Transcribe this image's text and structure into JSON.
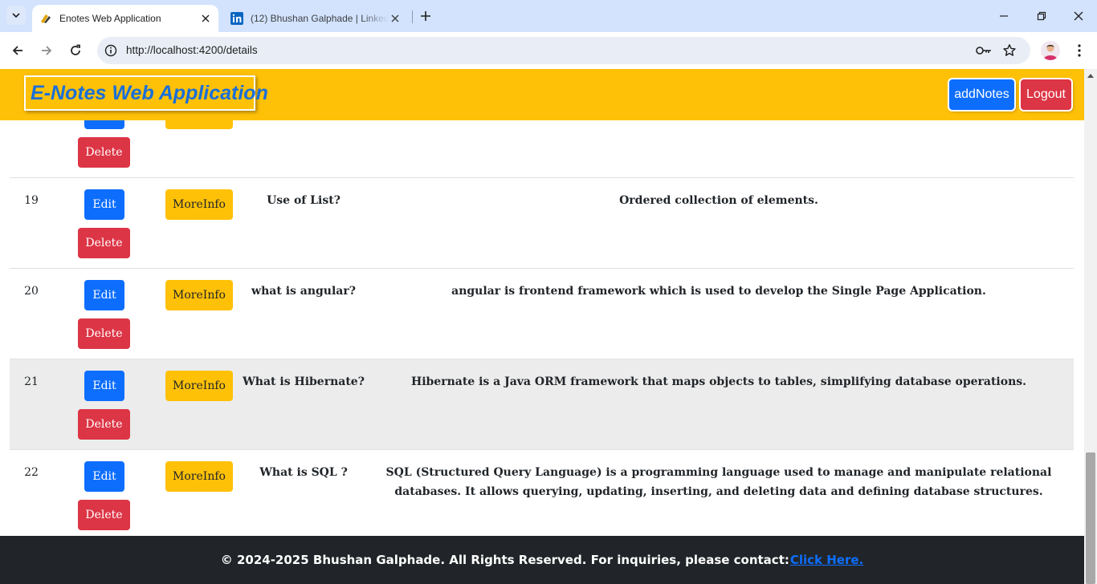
{
  "browser": {
    "tabs": [
      {
        "title": "Enotes Web Application",
        "active": true
      },
      {
        "title": "(12) Bhushan Galphade | LinkedIn",
        "active": false
      }
    ],
    "url": "http://localhost:4200/details"
  },
  "app": {
    "brand": "E-Notes Web Application",
    "add_notes_label": "addNotes",
    "logout_label": "Logout"
  },
  "table": {
    "buttons": {
      "edit": "Edit",
      "delete": "Delete",
      "more_info": "MoreInfo"
    },
    "rows": [
      {
        "id": "",
        "title": "",
        "description": ""
      },
      {
        "id": "19",
        "title": "Use of List?",
        "description": "Ordered collection of elements."
      },
      {
        "id": "20",
        "title": "what is angular?",
        "description": "angular is frontend framework which is used to develop the Single Page Application."
      },
      {
        "id": "21",
        "title": "What is Hibernate?",
        "description": "Hibernate is a Java ORM framework that maps objects to tables, simplifying database operations."
      },
      {
        "id": "22",
        "title": "What is SQL ?",
        "description": "SQL (Structured Query Language) is a programming language used to manage and manipulate relational databases. It allows querying, updating, inserting, and deleting data and defining database structures."
      }
    ]
  },
  "footer": {
    "text": "© 2024-2025 Bhushan Galphade. All Rights Reserved. For inquiries, please contact:",
    "link": "Click Here."
  },
  "colors": {
    "navbar": "#ffc107",
    "primary": "#0d6efd",
    "danger": "#dc3545",
    "warning": "#ffc107",
    "footer": "#212529",
    "brand_text": "#1a6fd8"
  },
  "icons": [
    "tab-search-icon",
    "enotes-favicon-icon",
    "linkedin-favicon-icon",
    "close-icon",
    "new-tab-icon",
    "minimize-icon",
    "restore-icon",
    "window-close-icon",
    "back-icon",
    "forward-icon",
    "reload-icon",
    "site-info-icon",
    "password-key-icon",
    "bookmark-star-icon",
    "profile-avatar",
    "more-menu-icon"
  ]
}
